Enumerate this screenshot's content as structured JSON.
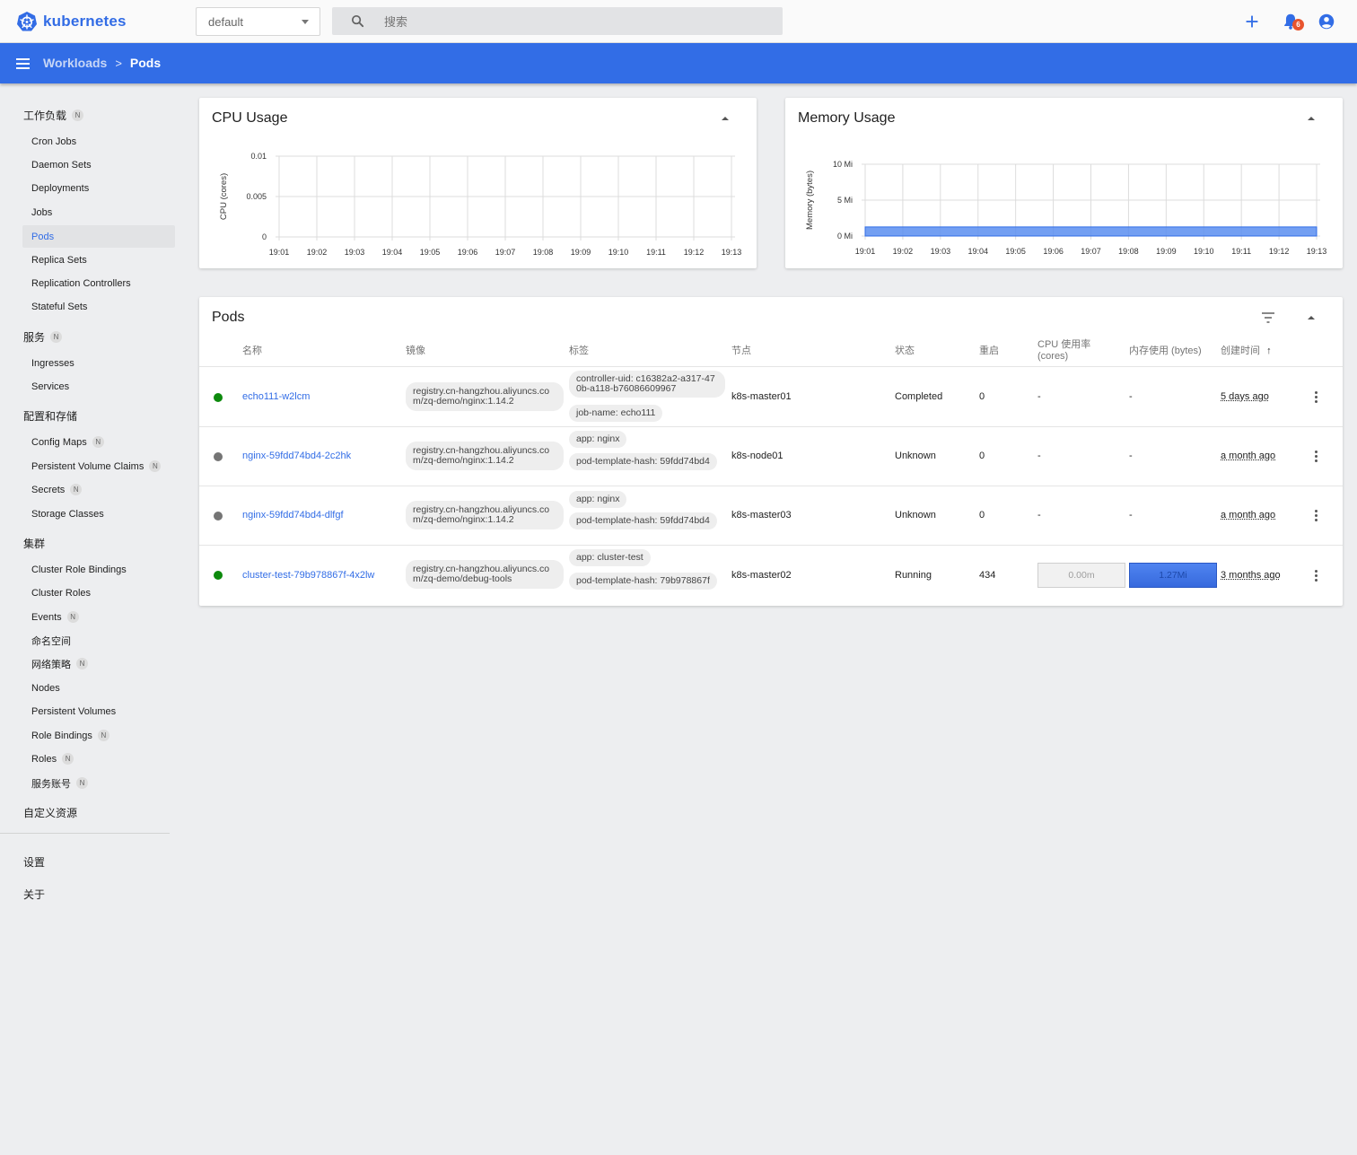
{
  "app": {
    "name": "kubernetes"
  },
  "namespace": {
    "selected": "default"
  },
  "search": {
    "placeholder": "搜索"
  },
  "notifications": {
    "count": "6"
  },
  "breadcrumb": {
    "parent": "Workloads",
    "separator": ">",
    "current": "Pods"
  },
  "sidebar": {
    "sections": [
      {
        "label": "工作负载",
        "badge": "N"
      },
      {
        "label": "服务",
        "badge": "N"
      },
      {
        "label": "配置和存储"
      },
      {
        "label": "集群"
      },
      {
        "label": "自定义资源"
      }
    ],
    "workloads": [
      "Cron Jobs",
      "Daemon Sets",
      "Deployments",
      "Jobs",
      "Pods",
      "Replica Sets",
      "Replication Controllers",
      "Stateful Sets"
    ],
    "services": [
      "Ingresses",
      "Services"
    ],
    "config": [
      {
        "label": "Config Maps",
        "badge": "N"
      },
      {
        "label": "Persistent Volume Claims",
        "badge": "N"
      },
      {
        "label": "Secrets",
        "badge": "N"
      },
      {
        "label": "Storage Classes"
      }
    ],
    "cluster": [
      {
        "label": "Cluster Role Bindings"
      },
      {
        "label": "Cluster Roles"
      },
      {
        "label": "Events",
        "badge": "N"
      },
      {
        "label": "命名空间"
      },
      {
        "label": "网络策略",
        "badge": "N"
      },
      {
        "label": "Nodes"
      },
      {
        "label": "Persistent Volumes"
      },
      {
        "label": "Role Bindings",
        "badge": "N"
      },
      {
        "label": "Roles",
        "badge": "N"
      },
      {
        "label": "服务账号",
        "badge": "N"
      }
    ],
    "settings": "设置",
    "about": "关于"
  },
  "colors": {
    "accent": "#326de6",
    "running": "#0d8a0d",
    "unknown": "#757575"
  },
  "cpu_chart": {
    "title": "CPU Usage",
    "ylabel": "CPU (cores)"
  },
  "mem_chart": {
    "title": "Memory Usage",
    "ylabel": "Memory (bytes)"
  },
  "chart_data": [
    {
      "type": "area",
      "title": "CPU Usage",
      "xlabel": "",
      "ylabel": "CPU (cores)",
      "categories": [
        "19:01",
        "19:02",
        "19:03",
        "19:04",
        "19:05",
        "19:06",
        "19:07",
        "19:08",
        "19:09",
        "19:10",
        "19:11",
        "19:12",
        "19:13"
      ],
      "yticks": [
        "0",
        "0.005",
        "0.01"
      ],
      "ylim": [
        0,
        0.01
      ],
      "values": [],
      "grid": true
    },
    {
      "type": "area",
      "title": "Memory Usage",
      "xlabel": "",
      "ylabel": "Memory (bytes)",
      "categories": [
        "19:01",
        "19:02",
        "19:03",
        "19:04",
        "19:05",
        "19:06",
        "19:07",
        "19:08",
        "19:09",
        "19:10",
        "19:11",
        "19:12",
        "19:13"
      ],
      "yticks": [
        "0 Mi",
        "5 Mi",
        "10 Mi"
      ],
      "ylim": [
        0,
        10
      ],
      "values": [
        1.27,
        1.27,
        1.27,
        1.27,
        1.27,
        1.27,
        1.27,
        1.27,
        1.27,
        1.27,
        1.27,
        1.27,
        1.27
      ],
      "grid": true
    }
  ],
  "pods": {
    "title": "Pods",
    "columns": {
      "name": "名称",
      "image": "镜像",
      "labels": "标签",
      "node": "节点",
      "status": "状态",
      "restarts": "重启",
      "cpu": "CPU 使用率",
      "cpu_unit": "(cores)",
      "memory": "内存使用 (bytes)",
      "created": "创建时间"
    },
    "rows": [
      {
        "status_color": "#0d8a0d",
        "name": "echo111-w2lcm",
        "image": "registry.cn-hangzhou.aliyuncs.com/zq-demo/nginx:1.14.2",
        "labels": [
          "controller-uid: c16382a2-a317-470b-a118-b76086609967",
          "job-name: echo111"
        ],
        "node": "k8s-master01",
        "status": "Completed",
        "restarts": "0",
        "cpu": "-",
        "memory": "-",
        "created": "5 days ago"
      },
      {
        "status_color": "#757575",
        "name": "nginx-59fdd74bd4-2c2hk",
        "image": "registry.cn-hangzhou.aliyuncs.com/zq-demo/nginx:1.14.2",
        "labels": [
          "app: nginx",
          "pod-template-hash: 59fdd74bd4"
        ],
        "node": "k8s-node01",
        "status": "Unknown",
        "restarts": "0",
        "cpu": "-",
        "memory": "-",
        "created": "a month ago"
      },
      {
        "status_color": "#757575",
        "name": "nginx-59fdd74bd4-dlfgf",
        "image": "registry.cn-hangzhou.aliyuncs.com/zq-demo/nginx:1.14.2",
        "labels": [
          "app: nginx",
          "pod-template-hash: 59fdd74bd4"
        ],
        "node": "k8s-master03",
        "status": "Unknown",
        "restarts": "0",
        "cpu": "-",
        "memory": "-",
        "created": "a month ago"
      },
      {
        "status_color": "#0d8a0d",
        "name": "cluster-test-79b978867f-4x2lw",
        "image": "registry.cn-hangzhou.aliyuncs.com/zq-demo/debug-tools",
        "labels": [
          "app: cluster-test",
          "pod-template-hash: 79b978867f"
        ],
        "node": "k8s-master02",
        "status": "Running",
        "restarts": "434",
        "cpu": "0.00m",
        "memory": "1.27Mi",
        "created": "3 months ago"
      }
    ]
  }
}
